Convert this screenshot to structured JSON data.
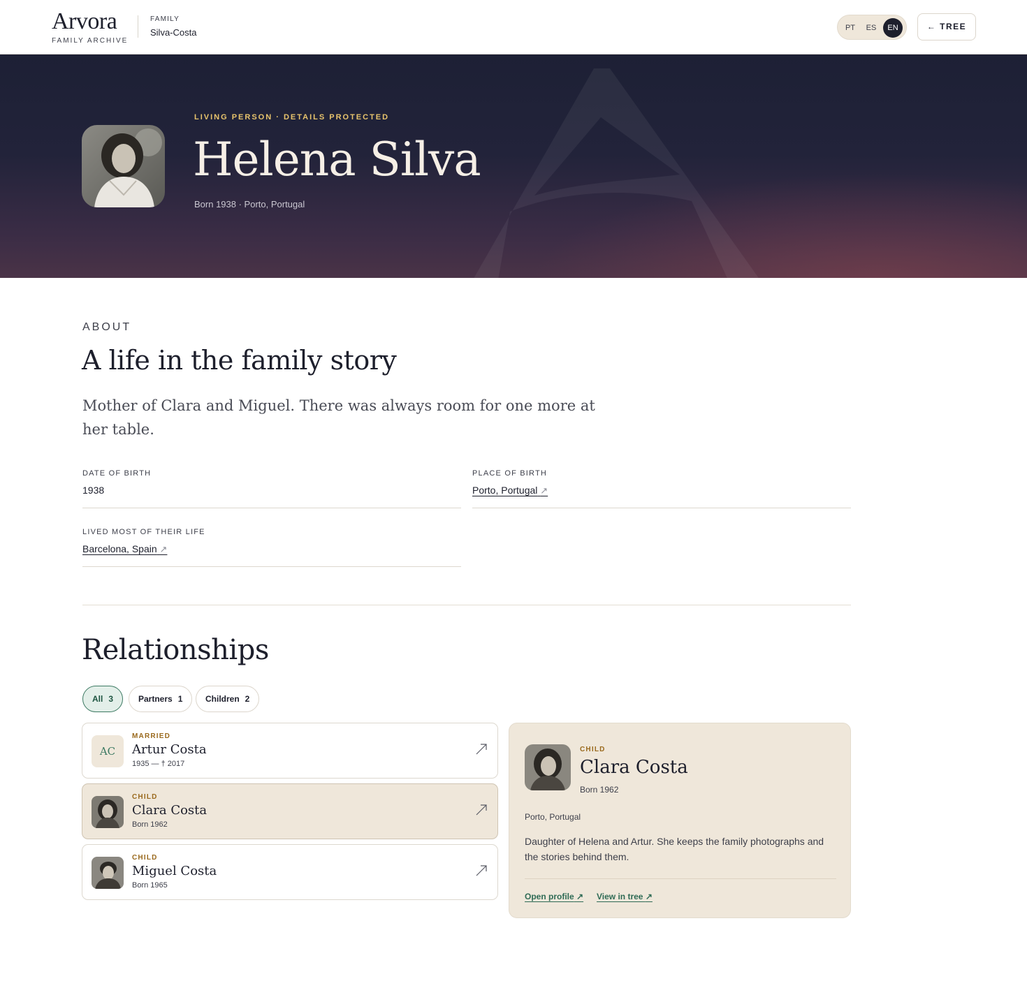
{
  "header": {
    "brand_name": "Arvora",
    "brand_sub": "FAMILY ARCHIVE",
    "family_label": "FAMILY",
    "family_name": "Silva-Costa",
    "languages": [
      "PT",
      "ES",
      "EN"
    ],
    "active_language": "EN",
    "back_label": "← TREE"
  },
  "hero": {
    "kicker": "LIVING PERSON · DETAILS PROTECTED",
    "name": "Helena Silva",
    "meta": "Born 1938 · Porto, Portugal",
    "portrait_icon": "person-photo"
  },
  "about": {
    "kicker": "ABOUT",
    "title": "A life in the family story",
    "text": "Mother of Clara and Miguel. There was always room for one more at her table.",
    "fields": [
      {
        "label": "DATE OF BIRTH",
        "value": "1938"
      },
      {
        "label": "PLACE OF BIRTH",
        "value": "Porto, Portugal"
      },
      {
        "label": "LIVED MOST OF THEIR LIFE",
        "value": "Barcelona, Spain"
      }
    ]
  },
  "relationships": {
    "title": "Relationships",
    "filters": [
      {
        "label": "All",
        "count": "3"
      },
      {
        "label": "Partners",
        "count": "1"
      },
      {
        "label": "Children",
        "count": "2"
      }
    ],
    "active_filter": "All",
    "items": [
      {
        "kind": "MARRIED",
        "name": "Artur Costa",
        "dates": "1935 — † 2017",
        "initials": "AC"
      },
      {
        "kind": "CHILD",
        "name": "Clara Costa",
        "dates": "Born 1962"
      },
      {
        "kind": "CHILD",
        "name": "Miguel Costa",
        "dates": "Born 1965"
      }
    ],
    "selected": "Clara Costa"
  },
  "detail": {
    "kind": "CHILD",
    "name": "Clara Costa",
    "born": "Born 1962",
    "place": "Porto, Portugal",
    "text": "Daughter of Helena and Artur. She keeps the family photographs and the stories behind them.",
    "open_profile": "Open profile",
    "view_in_tree": "View in tree"
  },
  "colors": {
    "hero_bg": "#1d2035",
    "accent_gold": "#e8c46c",
    "accent_green": "#2f6b55",
    "kind_label": "#9a6a1e",
    "sand": "#efe7da"
  }
}
